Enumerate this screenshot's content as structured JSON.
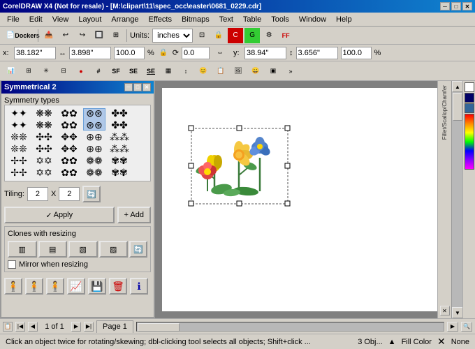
{
  "app": {
    "title": "CorelDRAW X4 (Not for resale) - [M:\\clipart\\11\\spec_occ\\easter\\0681_0229.cdr]",
    "inner_title": "M:\\clipart\\11\\spec_occ\\easter\\0681_0229.cdr"
  },
  "menu": {
    "items": [
      "File",
      "Edit",
      "View",
      "Layout",
      "Arrange",
      "Effects",
      "Bitmaps",
      "Text",
      "Table",
      "Tools",
      "Window",
      "Help"
    ]
  },
  "toolbar": {
    "units_label": "Units:",
    "units_value": "inches"
  },
  "coords": {
    "x_label": "x:",
    "x_value": "38.182\"",
    "y_label": "y:",
    "y_value": "38.94\"",
    "w_label": "",
    "w_value": "3.898\"",
    "h_value": "3.656\"",
    "scale_x": "100.0",
    "scale_y": "100.0",
    "pct": "%",
    "angle": "0.0"
  },
  "sym_panel": {
    "title": "Symmetrical 2",
    "section_label": "Symmetry types",
    "tiling_label": "Tiling:",
    "tiling_x": "2",
    "tiling_x_label": "X",
    "tiling_y": "2",
    "apply_label": "Apply",
    "add_label": "+ Add",
    "clones_label": "Clones with resizing",
    "mirror_label": "Mirror when resizing"
  },
  "page_nav": {
    "page_indicator": "1 of 1",
    "page_tab_label": "Page 1"
  },
  "status": {
    "objects": "3 Obj...",
    "fill_label": "Fill Color",
    "none_label": "None",
    "hint": "Click an object twice for rotating/skewing; dbl-clicking tool selects all objects; Shift+click ..."
  }
}
